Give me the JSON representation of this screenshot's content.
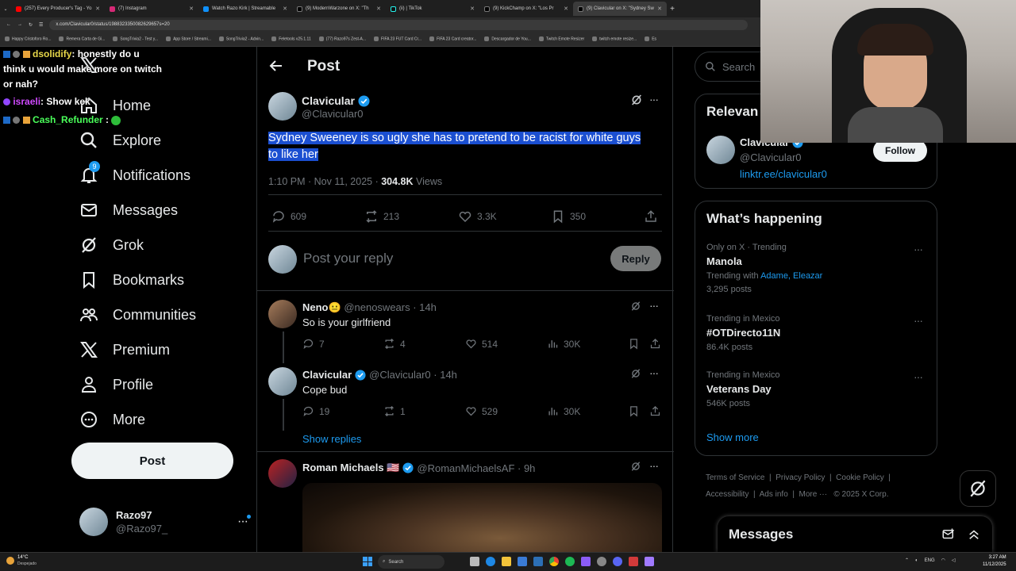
{
  "browser": {
    "tabs": [
      {
        "label": "(257) Every Producer's Tag - Yo"
      },
      {
        "label": "(7) Instagram"
      },
      {
        "label": "Watch Razo Kirk | Streamable"
      },
      {
        "label": "(9) ModernWarzone on X: \"Th"
      },
      {
        "label": "(ii) | TikTok"
      },
      {
        "label": "(9) KickChamp on X: \"Los Pr"
      },
      {
        "label": "(9) Clavicular on X: \"Sydney Sw"
      }
    ],
    "url": "x.com/Clavicular0/status/1988323350082629657s=20",
    "bookmarks": [
      "Happy Cristoforo Ro...",
      "Remera Carta de Gi...",
      "SongTrivia2 - Test y...",
      "App Store / Streami...",
      "SongTrivia2 - Advin...",
      "Feletools v25.1.11",
      "(77) Razo97s Zest-A...",
      "FIFA 23 FUT Card Cr...",
      "FIFA 23 Card creator...",
      "Descargador de You...",
      "Twitch Emote Resizer",
      "twitch emote resize...",
      "Es"
    ]
  },
  "chat": [
    {
      "user": "dsolidify",
      "color": "#e8d84a",
      "text": ": honestly do u"
    },
    {
      "user": "",
      "color": "#fff",
      "text": "think u would make more on twitch"
    },
    {
      "user": "",
      "color": "#fff",
      "text": "or nah?"
    },
    {
      "user": "israeli",
      "color": "#d04aff",
      "text": ": Show kek"
    },
    {
      "user": "Cash_Refunder",
      "color": "#4aff5a",
      "text": " :"
    }
  ],
  "nav": {
    "items": [
      {
        "label": "Home",
        "icon": "home-icon"
      },
      {
        "label": "Explore",
        "icon": "search-icon"
      },
      {
        "label": "Notifications",
        "icon": "bell-icon",
        "badge": "9"
      },
      {
        "label": "Messages",
        "icon": "mail-icon"
      },
      {
        "label": "Grok",
        "icon": "grok-icon"
      },
      {
        "label": "Bookmarks",
        "icon": "bookmark-icon"
      },
      {
        "label": "Communities",
        "icon": "people-icon"
      },
      {
        "label": "Premium",
        "icon": "x-logo-icon"
      },
      {
        "label": "Profile",
        "icon": "person-icon"
      },
      {
        "label": "More",
        "icon": "more-circle-icon"
      }
    ],
    "post_label": "Post",
    "account": {
      "name": "Razo97",
      "handle": "@Razo97_"
    }
  },
  "header": {
    "title": "Post"
  },
  "post": {
    "author": "Clavicular",
    "handle": "@Clavicular0",
    "text_line1": "Sydney Sweeney is so ugly she has to pretend to be racist for white guys",
    "text_line2": "to like her",
    "time": "1:10 PM · Nov 11, 2025 · ",
    "views": "304.8K",
    "views_label": " Views",
    "replies": "609",
    "reposts": "213",
    "likes": "3.3K",
    "bookmarks": "350"
  },
  "composer": {
    "placeholder": "Post your reply",
    "button": "Reply"
  },
  "replies": [
    {
      "author": "Neno😐",
      "handle": "@nenoswears · 14h",
      "text": "So is your girlfriend",
      "replies": "7",
      "reposts": "4",
      "likes": "514",
      "views": "30K"
    },
    {
      "author": "Clavicular",
      "handle": "@Clavicular0 · 14h",
      "text": "Cope bud",
      "replies": "19",
      "reposts": "1",
      "likes": "529",
      "views": "30K"
    }
  ],
  "show_replies": "Show replies",
  "third_reply": {
    "author": "Roman Michaels 🇺🇸",
    "handle": "@RomanMichaelsAF · 9h"
  },
  "right": {
    "search_placeholder": "Search",
    "relevant_title": "Relevan",
    "relevant": {
      "name": "Clavicular",
      "handle": "@Clavicular0",
      "link": "linktr.ee/clavicular0",
      "follow": "Follow"
    },
    "happening_title": "What’s happening",
    "trends": [
      {
        "meta": "Only on X · Trending",
        "name": "Manola",
        "extra_prefix": "Trending with ",
        "extra_link": "Adame, Eleazar",
        "posts": "3,295 posts"
      },
      {
        "meta": "Trending in Mexico",
        "name": "#OTDirecto11N",
        "posts": "86.4K posts"
      },
      {
        "meta": "Trending in Mexico",
        "name": "Veterans Day",
        "posts": "546K posts"
      }
    ],
    "show_more": "Show more",
    "footer": [
      "Terms of Service",
      "Privacy Policy",
      "Cookie Policy",
      "Accessibility",
      "Ads info",
      "More ···",
      "© 2025 X Corp."
    ],
    "messages_title": "Messages"
  },
  "taskbar": {
    "weather_temp": "14°C",
    "weather_desc": "Despejado",
    "search": "Search",
    "lang": "ENG",
    "time": "3:27 AM",
    "date": "11/12/2025"
  },
  "colors": {
    "accent": "#1d9bf0",
    "highlight": "#1b4fd1",
    "verified": "#1d9bf0"
  }
}
